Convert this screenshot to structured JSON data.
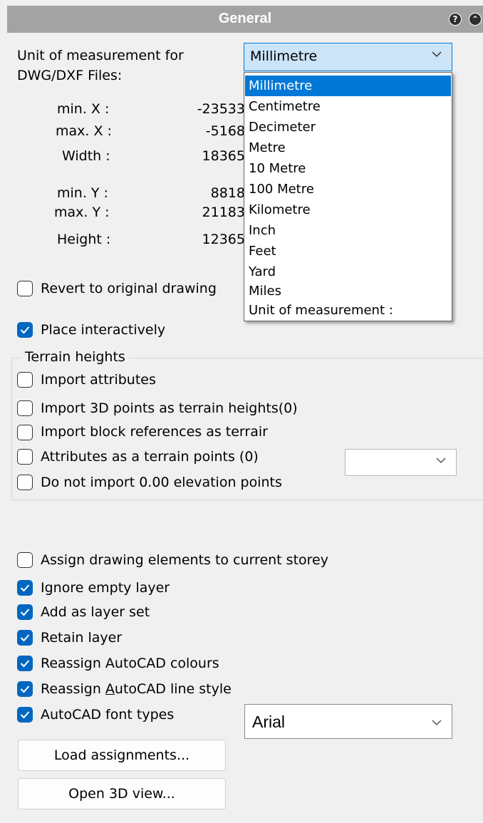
{
  "panel": {
    "title": "General"
  },
  "unit": {
    "label_line1": "Unit of measurement for",
    "label_line2": "DWG/DXF Files:",
    "selected": "Millimetre",
    "options": [
      "Millimetre",
      "Centimetre",
      "Decimeter",
      "Metre",
      "10 Metre",
      "100 Metre",
      "Kilometre",
      "Inch",
      "Feet",
      "Yard",
      "Miles",
      "Unit of measurement :"
    ]
  },
  "extents": {
    "min_x_label": "min. X :",
    "min_x_value": "-23533",
    "max_x_label": "max. X :",
    "max_x_value": "-5168",
    "width_label": "Width :",
    "width_value": "18365",
    "min_y_label": "min. Y :",
    "min_y_value": "8818",
    "max_y_label": "max. Y :",
    "max_y_value": "21183",
    "height_label": "Height :",
    "height_value": "12365"
  },
  "options": {
    "revert": {
      "label": "Revert to original drawing",
      "checked": false
    },
    "place": {
      "label": "Place interactively",
      "checked": true
    }
  },
  "terrain": {
    "title": "Terrain heights",
    "import_attributes": {
      "label": "Import attributes",
      "checked": false
    },
    "import_3d": {
      "label": "Import 3D points as terrain heights(0)",
      "checked": false
    },
    "import_block": {
      "label": "Import block references as terrair",
      "checked": false
    },
    "attributes_terrain": {
      "label": "Attributes as a terrain points (0)",
      "checked": false
    },
    "no_zero": {
      "label": "Do not import 0.00 elevation points",
      "checked": false
    },
    "attr_select_value": ""
  },
  "layers": {
    "assign_storey": {
      "label": "Assign drawing elements to current storey",
      "checked": false
    },
    "ignore_empty": {
      "label": "Ignore empty layer",
      "checked": true
    },
    "add_layer_set": {
      "label": "Add as layer set",
      "checked": true
    },
    "retain_layer": {
      "label": "Retain layer",
      "checked": true
    },
    "reassign_colours": {
      "label": "Reassign AutoCAD colours",
      "checked": true
    },
    "reassign_line_pre": "Reassign ",
    "reassign_line_u": "A",
    "reassign_line_post": "utoCAD line style",
    "reassign_line_checked": true,
    "font_types": {
      "label": "AutoCAD font types",
      "checked": true
    },
    "font_value": "Arial"
  },
  "buttons": {
    "load": "Load assignments...",
    "open3d": "Open 3D view..."
  },
  "icons": {
    "help": "help-icon",
    "collapse": "collapse-icon",
    "check": "check-icon",
    "chevron": "chevron-down-icon"
  }
}
